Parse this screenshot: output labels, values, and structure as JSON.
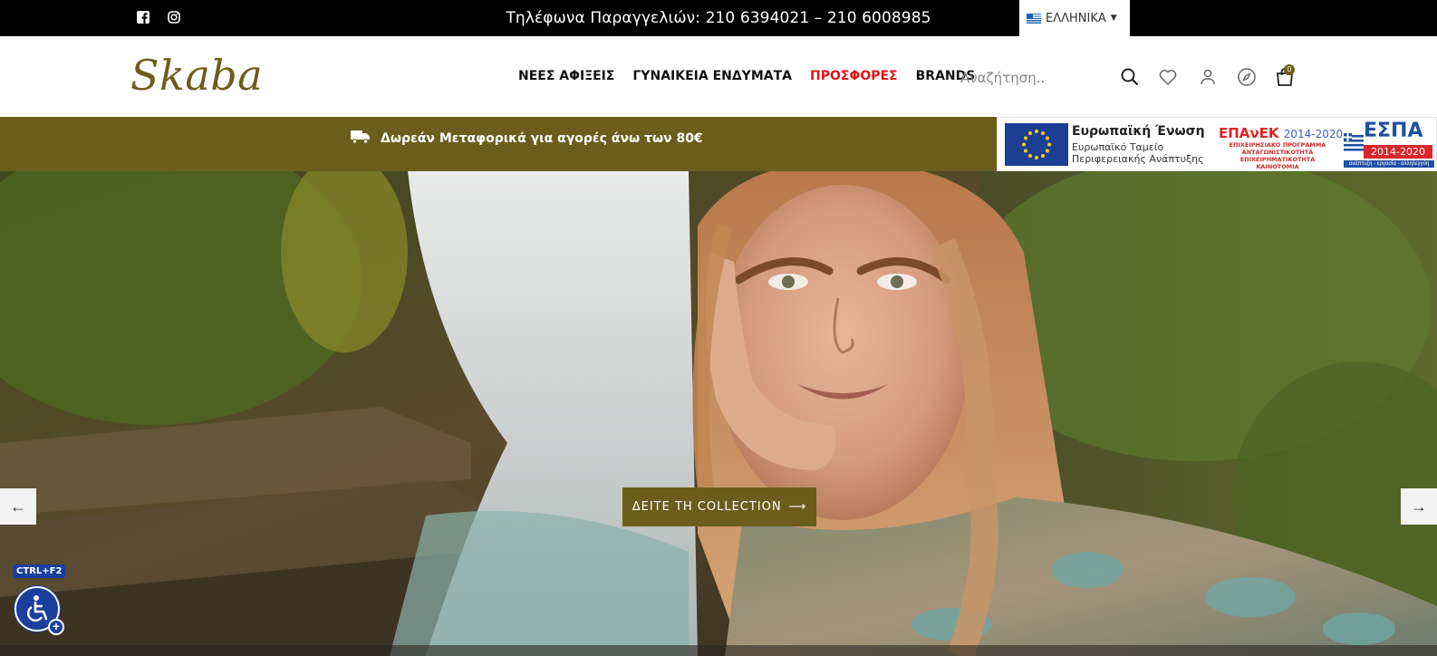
{
  "topbar": {
    "phones": "Τηλέφωνα Παραγγελιών: 210 6394021 – 210 6008985",
    "language": "ΕΛΛΗΝΙΚΑ",
    "social_icons": [
      "facebook-icon",
      "instagram-icon"
    ]
  },
  "header": {
    "logo": "Skaba",
    "nav": [
      {
        "label": "ΝΕΕΣ ΑΦΙΞΕΙΣ"
      },
      {
        "label": "ΓΥΝΑΙΚΕΙΑ ΕΝΔΥΜΑΤΑ"
      },
      {
        "label": "ΠΡΟΣΦΟΡΕΣ",
        "color": "#e0151b"
      },
      {
        "label": "BRANDS"
      }
    ],
    "search_placeholder": "Αναζήτηση..",
    "cart_count": "0",
    "icons": [
      "search-icon",
      "heart-icon",
      "user-icon",
      "compass-icon",
      "bag-icon"
    ]
  },
  "promo": {
    "text": "Δωρεάν Μεταφορικά για αγορές άνω των 80€",
    "icon": "truck-icon",
    "background": "#6b5e1c"
  },
  "espa": {
    "eu_title": "Ευρωπαϊκή Ένωση",
    "eu_sub_1": "Ευρωπαϊκό Ταμείο",
    "eu_sub_2": "Περιφερειακής Ανάπτυξης",
    "epanek": "ΕΠΑνΕΚ",
    "epanek_years": "2014-2020",
    "epanek_sub": "ΕΠΙΧΕΙΡΗΣΙΑΚΟ ΠΡΟΓΡΑΜΜΑ ΑΝΤΑΓΩΝΙΣΤΙΚΟΤΗΤΑ ΕΠΙΧΕΙΡΗΜΑΤΙΚΟΤΗΤΑ ΚΑΙΝΟΤΟΜΙΑ",
    "espa": "ΕΣΠΑ",
    "espa_years": "2014-2020",
    "espa_tag": "ανάπτυξη - εργασία - αλληλεγγύη"
  },
  "hero": {
    "cta": "ΔΕΙΤΕ ΤΗ COLLECTION",
    "prev": "←",
    "next": "→"
  },
  "accessibility": {
    "hotkey": "CTRL+F2",
    "plus": "+"
  },
  "colors": {
    "accent": "#6b5e1c",
    "sale": "#e0151b",
    "accessibility": "#1a3f9c"
  }
}
